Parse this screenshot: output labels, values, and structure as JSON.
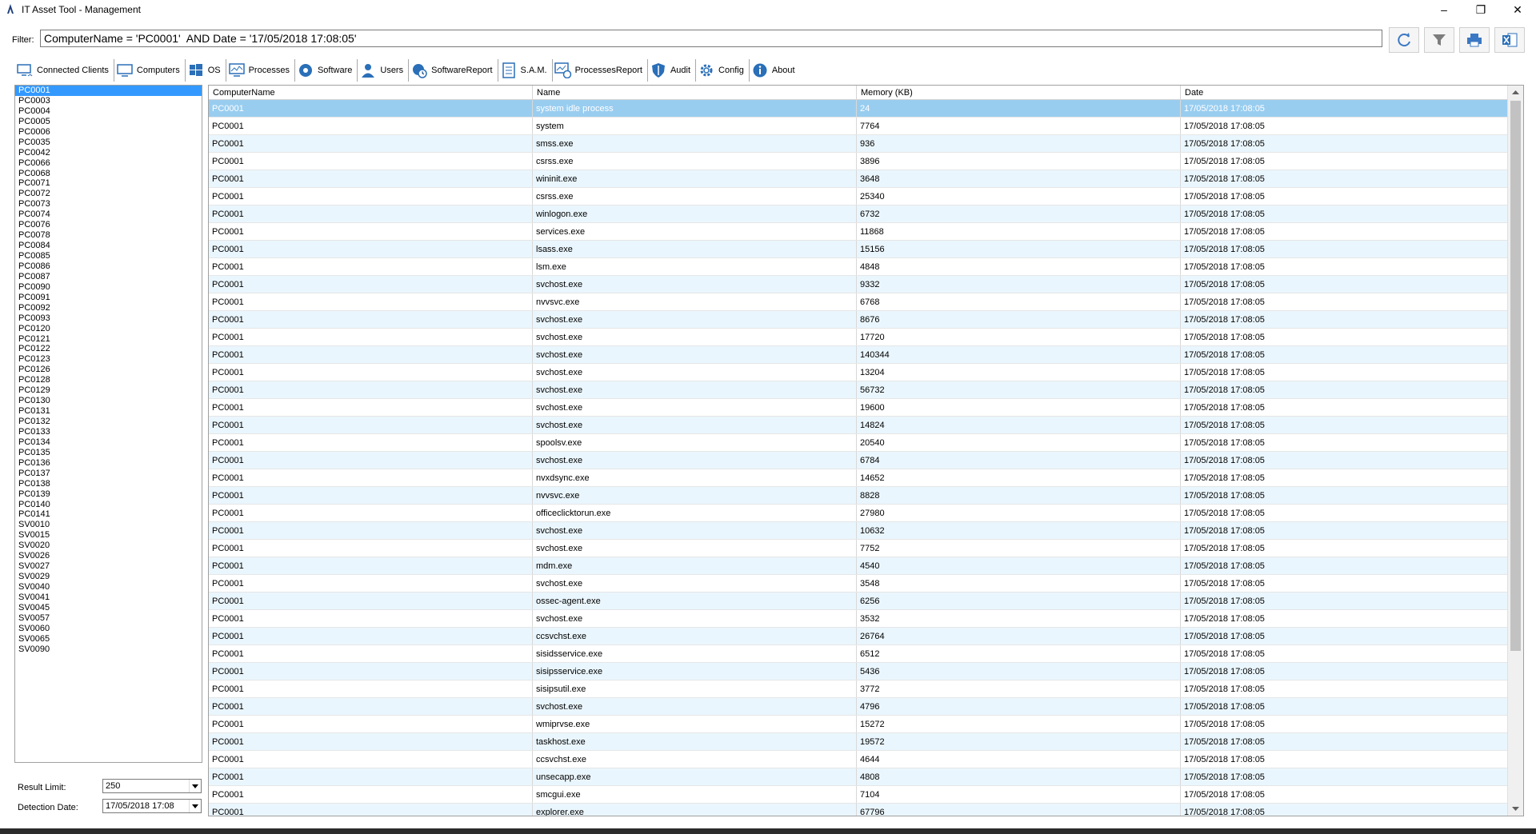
{
  "window": {
    "title": "IT Asset Tool - Management",
    "minimize": "–",
    "restore": "❐",
    "close": "✕"
  },
  "filter": {
    "label": "Filter:",
    "value": "ComputerName = 'PC0001'  AND Date = '17/05/2018 17:08:05'"
  },
  "toolbar_icons": [
    "refresh-icon",
    "filter-icon",
    "print-icon",
    "excel-export-icon"
  ],
  "tabs": [
    {
      "label": "Connected Clients",
      "icon": "connected-clients-icon"
    },
    {
      "label": "Computers",
      "icon": "computer-icon"
    },
    {
      "label": "OS",
      "icon": "windows-icon"
    },
    {
      "label": "Processes",
      "icon": "processes-icon",
      "active": true
    },
    {
      "label": "Software",
      "icon": "software-icon"
    },
    {
      "label": "Users",
      "icon": "user-icon"
    },
    {
      "label": "SoftwareReport",
      "icon": "software-report-icon"
    },
    {
      "label": "S.A.M.",
      "icon": "sam-icon"
    },
    {
      "label": "ProcessesReport",
      "icon": "processes-report-icon"
    },
    {
      "label": "Audit",
      "icon": "shield-icon"
    },
    {
      "label": "Config",
      "icon": "gear-icon"
    },
    {
      "label": "About",
      "icon": "info-icon"
    }
  ],
  "computers": [
    "PC0001",
    "PC0003",
    "PC0004",
    "PC0005",
    "PC0006",
    "PC0035",
    "PC0042",
    "PC0066",
    "PC0068",
    "PC0071",
    "PC0072",
    "PC0073",
    "PC0074",
    "PC0076",
    "PC0078",
    "PC0084",
    "PC0085",
    "PC0086",
    "PC0087",
    "PC0090",
    "PC0091",
    "PC0092",
    "PC0093",
    "PC0120",
    "PC0121",
    "PC0122",
    "PC0123",
    "PC0126",
    "PC0128",
    "PC0129",
    "PC0130",
    "PC0131",
    "PC0132",
    "PC0133",
    "PC0134",
    "PC0135",
    "PC0136",
    "PC0137",
    "PC0138",
    "PC0139",
    "PC0140",
    "PC0141",
    "SV0010",
    "SV0015",
    "SV0020",
    "SV0026",
    "SV0027",
    "SV0029",
    "SV0040",
    "SV0041",
    "SV0045",
    "SV0057",
    "SV0060",
    "SV0065",
    "SV0090"
  ],
  "controls": {
    "result_limit_label": "Result Limit:",
    "result_limit_value": "250",
    "detection_date_label": "Detection Date:",
    "detection_date_value": "17/05/2018 17:08"
  },
  "grid": {
    "columns": [
      "ComputerName",
      "Name",
      "Memory (KB)",
      "Date"
    ],
    "rows": [
      [
        "PC0001",
        "system idle process",
        "24",
        "17/05/2018 17:08:05"
      ],
      [
        "PC0001",
        "system",
        "7764",
        "17/05/2018 17:08:05"
      ],
      [
        "PC0001",
        "smss.exe",
        "936",
        "17/05/2018 17:08:05"
      ],
      [
        "PC0001",
        "csrss.exe",
        "3896",
        "17/05/2018 17:08:05"
      ],
      [
        "PC0001",
        "wininit.exe",
        "3648",
        "17/05/2018 17:08:05"
      ],
      [
        "PC0001",
        "csrss.exe",
        "25340",
        "17/05/2018 17:08:05"
      ],
      [
        "PC0001",
        "winlogon.exe",
        "6732",
        "17/05/2018 17:08:05"
      ],
      [
        "PC0001",
        "services.exe",
        "11868",
        "17/05/2018 17:08:05"
      ],
      [
        "PC0001",
        "lsass.exe",
        "15156",
        "17/05/2018 17:08:05"
      ],
      [
        "PC0001",
        "lsm.exe",
        "4848",
        "17/05/2018 17:08:05"
      ],
      [
        "PC0001",
        "svchost.exe",
        "9332",
        "17/05/2018 17:08:05"
      ],
      [
        "PC0001",
        "nvvsvc.exe",
        "6768",
        "17/05/2018 17:08:05"
      ],
      [
        "PC0001",
        "svchost.exe",
        "8676",
        "17/05/2018 17:08:05"
      ],
      [
        "PC0001",
        "svchost.exe",
        "17720",
        "17/05/2018 17:08:05"
      ],
      [
        "PC0001",
        "svchost.exe",
        "140344",
        "17/05/2018 17:08:05"
      ],
      [
        "PC0001",
        "svchost.exe",
        "13204",
        "17/05/2018 17:08:05"
      ],
      [
        "PC0001",
        "svchost.exe",
        "56732",
        "17/05/2018 17:08:05"
      ],
      [
        "PC0001",
        "svchost.exe",
        "19600",
        "17/05/2018 17:08:05"
      ],
      [
        "PC0001",
        "svchost.exe",
        "14824",
        "17/05/2018 17:08:05"
      ],
      [
        "PC0001",
        "spoolsv.exe",
        "20540",
        "17/05/2018 17:08:05"
      ],
      [
        "PC0001",
        "svchost.exe",
        "6784",
        "17/05/2018 17:08:05"
      ],
      [
        "PC0001",
        "nvxdsync.exe",
        "14652",
        "17/05/2018 17:08:05"
      ],
      [
        "PC0001",
        "nvvsvc.exe",
        "8828",
        "17/05/2018 17:08:05"
      ],
      [
        "PC0001",
        "officeclicktorun.exe",
        "27980",
        "17/05/2018 17:08:05"
      ],
      [
        "PC0001",
        "svchost.exe",
        "10632",
        "17/05/2018 17:08:05"
      ],
      [
        "PC0001",
        "svchost.exe",
        "7752",
        "17/05/2018 17:08:05"
      ],
      [
        "PC0001",
        "mdm.exe",
        "4540",
        "17/05/2018 17:08:05"
      ],
      [
        "PC0001",
        "svchost.exe",
        "3548",
        "17/05/2018 17:08:05"
      ],
      [
        "PC0001",
        "ossec-agent.exe",
        "6256",
        "17/05/2018 17:08:05"
      ],
      [
        "PC0001",
        "svchost.exe",
        "3532",
        "17/05/2018 17:08:05"
      ],
      [
        "PC0001",
        "ccsvchst.exe",
        "26764",
        "17/05/2018 17:08:05"
      ],
      [
        "PC0001",
        "sisidsservice.exe",
        "6512",
        "17/05/2018 17:08:05"
      ],
      [
        "PC0001",
        "sisipsservice.exe",
        "5436",
        "17/05/2018 17:08:05"
      ],
      [
        "PC0001",
        "sisipsutil.exe",
        "3772",
        "17/05/2018 17:08:05"
      ],
      [
        "PC0001",
        "svchost.exe",
        "4796",
        "17/05/2018 17:08:05"
      ],
      [
        "PC0001",
        "wmiprvse.exe",
        "15272",
        "17/05/2018 17:08:05"
      ],
      [
        "PC0001",
        "taskhost.exe",
        "19572",
        "17/05/2018 17:08:05"
      ],
      [
        "PC0001",
        "ccsvchst.exe",
        "4644",
        "17/05/2018 17:08:05"
      ],
      [
        "PC0001",
        "unsecapp.exe",
        "4808",
        "17/05/2018 17:08:05"
      ],
      [
        "PC0001",
        "smcgui.exe",
        "7104",
        "17/05/2018 17:08:05"
      ],
      [
        "PC0001",
        "explorer.exe",
        "67796",
        "17/05/2018 17:08:05"
      ]
    ]
  },
  "colors": {
    "selection": "#3399ff",
    "row_selected": "#99cdf0",
    "row_alt": "#eaf6fd"
  }
}
